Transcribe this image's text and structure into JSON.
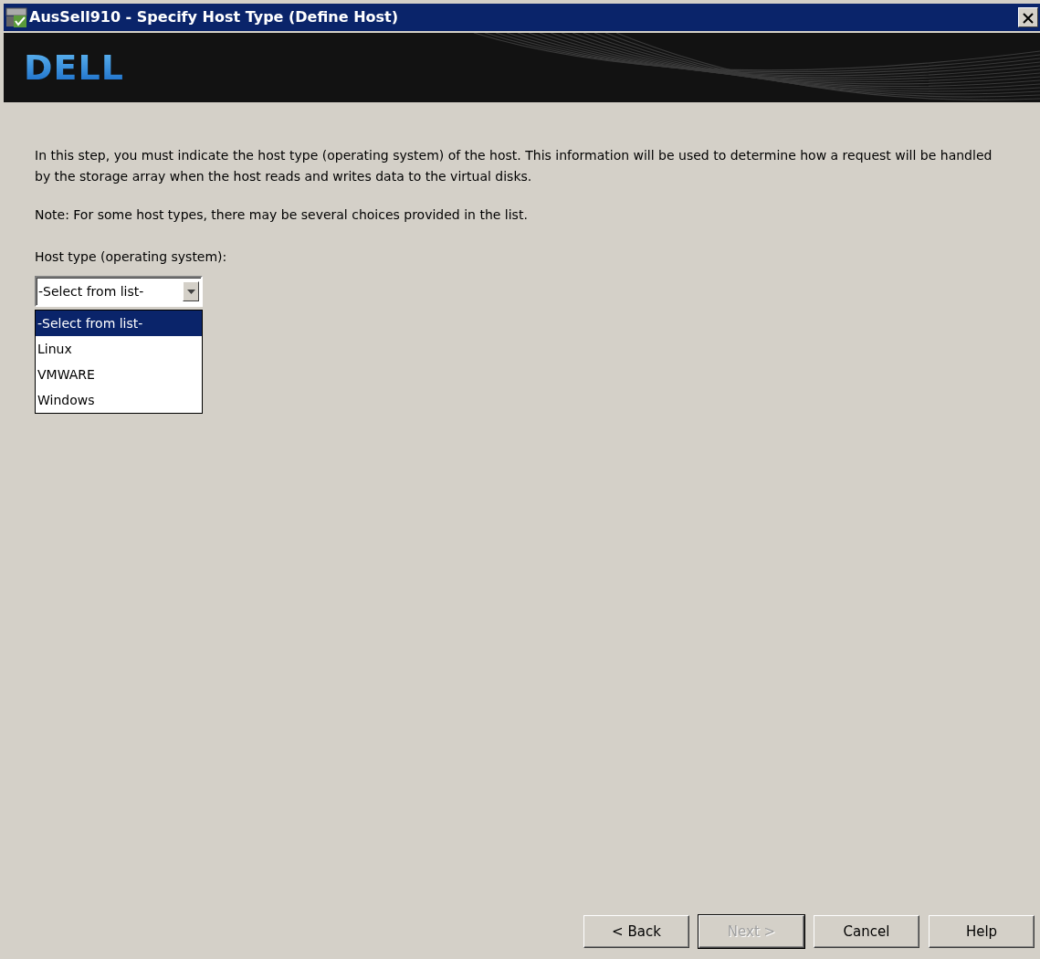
{
  "window": {
    "title": "AusSell910 - Specify Host Type (Define Host)"
  },
  "banner": {
    "logo": "DELL"
  },
  "description": "In this step, you must indicate the host type (operating system) of the host. This information will be used to determine how a request will be handled by the storage array when the host reads and writes data to the virtual disks.",
  "note": "Note: For some host types, there may be several choices provided in the list.",
  "host_type": {
    "label": "Host type (operating system):",
    "value": "-Select from list-",
    "expanded": true,
    "options": [
      {
        "label": "-Select from list-",
        "selected": true
      },
      {
        "label": "Linux",
        "selected": false
      },
      {
        "label": "VMWARE",
        "selected": false
      },
      {
        "label": "Windows",
        "selected": false
      }
    ]
  },
  "buttons": [
    {
      "label": "< Back",
      "disabled": false,
      "default": false
    },
    {
      "label": "Next >",
      "disabled": true,
      "default": true
    },
    {
      "label": "Cancel",
      "disabled": false,
      "default": false
    },
    {
      "label": "Help",
      "disabled": false,
      "default": false
    }
  ]
}
